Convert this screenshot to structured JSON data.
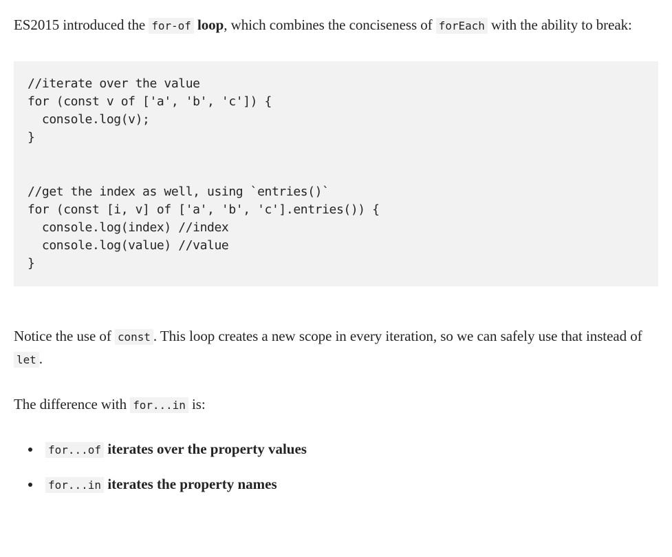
{
  "para1": {
    "t1": "ES2015 introduced the ",
    "code1": "for-of",
    "t2": " loop",
    "t3": ", which combines the conciseness of ",
    "code2": "forEach",
    "t4": " with the ability to break:"
  },
  "codeblock": "//iterate over the value\nfor (const v of ['a', 'b', 'c']) {\n  console.log(v);\n}\n\n\n//get the index as well, using `entries()`\nfor (const [i, v] of ['a', 'b', 'c'].entries()) {\n  console.log(index) //index\n  console.log(value) //value\n}",
  "para2": {
    "t1": "Notice the use of ",
    "code1": "const",
    "t2": ". This loop creates a new scope in every iteration, so we can safely use that instead of ",
    "code2": "let",
    "t3": "."
  },
  "para3": {
    "t1": "The difference with ",
    "code1": "for...in",
    "t2": " is:"
  },
  "bullets": {
    "b1": {
      "code": "for...of",
      "text": " iterates over the property values"
    },
    "b2": {
      "code": "for...in",
      "text": " iterates the property names"
    }
  }
}
